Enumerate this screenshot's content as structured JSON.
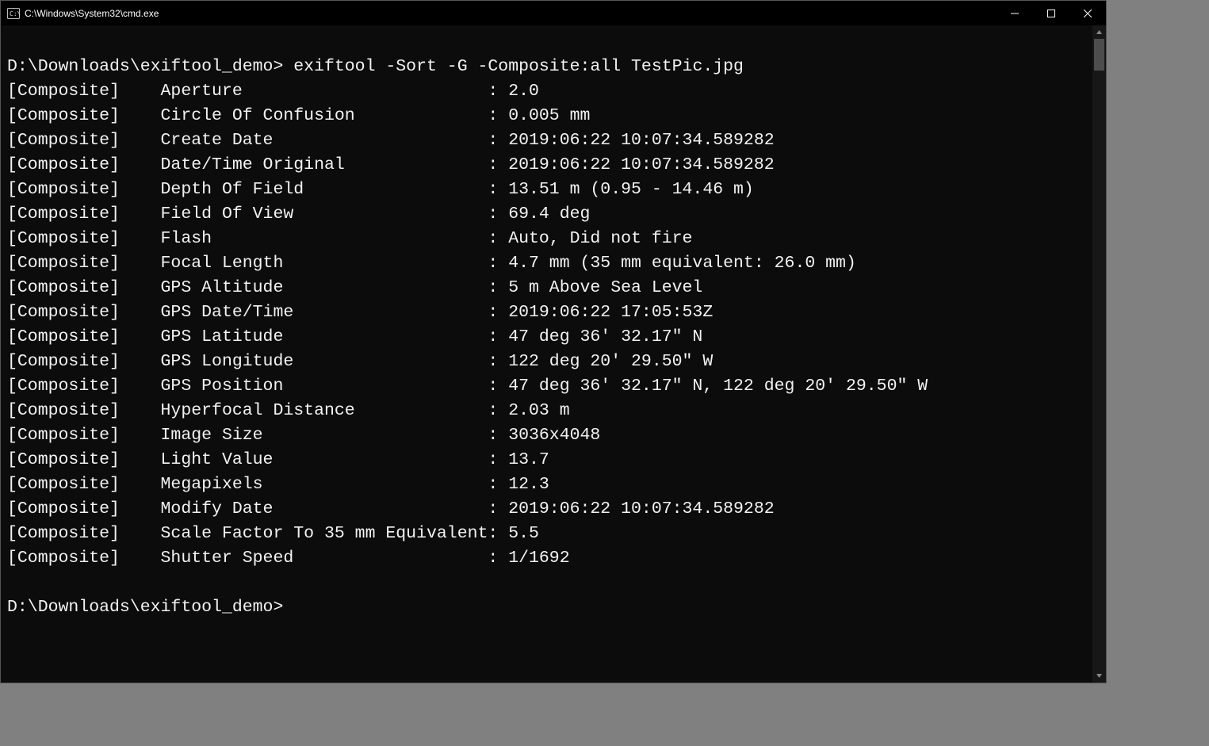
{
  "window": {
    "title": "C:\\Windows\\System32\\cmd.exe"
  },
  "prompt": {
    "full_line": "D:\\Downloads\\exiftool_demo> exiftool -Sort -G -Composite:all TestPic.jpg",
    "path": "D:\\Downloads\\exiftool_demo>",
    "command": "exiftool -Sort -G -Composite:all TestPic.jpg",
    "trailing": "D:\\Downloads\\exiftool_demo>"
  },
  "output": {
    "rows": [
      {
        "group": "[Composite]",
        "tag": "Aperture",
        "value": "2.0"
      },
      {
        "group": "[Composite]",
        "tag": "Circle Of Confusion",
        "value": "0.005 mm"
      },
      {
        "group": "[Composite]",
        "tag": "Create Date",
        "value": "2019:06:22 10:07:34.589282"
      },
      {
        "group": "[Composite]",
        "tag": "Date/Time Original",
        "value": "2019:06:22 10:07:34.589282"
      },
      {
        "group": "[Composite]",
        "tag": "Depth Of Field",
        "value": "13.51 m (0.95 - 14.46 m)"
      },
      {
        "group": "[Composite]",
        "tag": "Field Of View",
        "value": "69.4 deg"
      },
      {
        "group": "[Composite]",
        "tag": "Flash",
        "value": "Auto, Did not fire"
      },
      {
        "group": "[Composite]",
        "tag": "Focal Length",
        "value": "4.7 mm (35 mm equivalent: 26.0 mm)"
      },
      {
        "group": "[Composite]",
        "tag": "GPS Altitude",
        "value": "5 m Above Sea Level"
      },
      {
        "group": "[Composite]",
        "tag": "GPS Date/Time",
        "value": "2019:06:22 17:05:53Z"
      },
      {
        "group": "[Composite]",
        "tag": "GPS Latitude",
        "value": "47 deg 36' 32.17\" N"
      },
      {
        "group": "[Composite]",
        "tag": "GPS Longitude",
        "value": "122 deg 20' 29.50\" W"
      },
      {
        "group": "[Composite]",
        "tag": "GPS Position",
        "value": "47 deg 36' 32.17\" N, 122 deg 20' 29.50\" W"
      },
      {
        "group": "[Composite]",
        "tag": "Hyperfocal Distance",
        "value": "2.03 m"
      },
      {
        "group": "[Composite]",
        "tag": "Image Size",
        "value": "3036x4048"
      },
      {
        "group": "[Composite]",
        "tag": "Light Value",
        "value": "13.7"
      },
      {
        "group": "[Composite]",
        "tag": "Megapixels",
        "value": "12.3"
      },
      {
        "group": "[Composite]",
        "tag": "Modify Date",
        "value": "2019:06:22 10:07:34.589282"
      },
      {
        "group": "[Composite]",
        "tag": "Scale Factor To 35 mm Equivalent",
        "value": "5.5"
      },
      {
        "group": "[Composite]",
        "tag": "Shutter Speed",
        "value": "1/1692"
      }
    ]
  }
}
